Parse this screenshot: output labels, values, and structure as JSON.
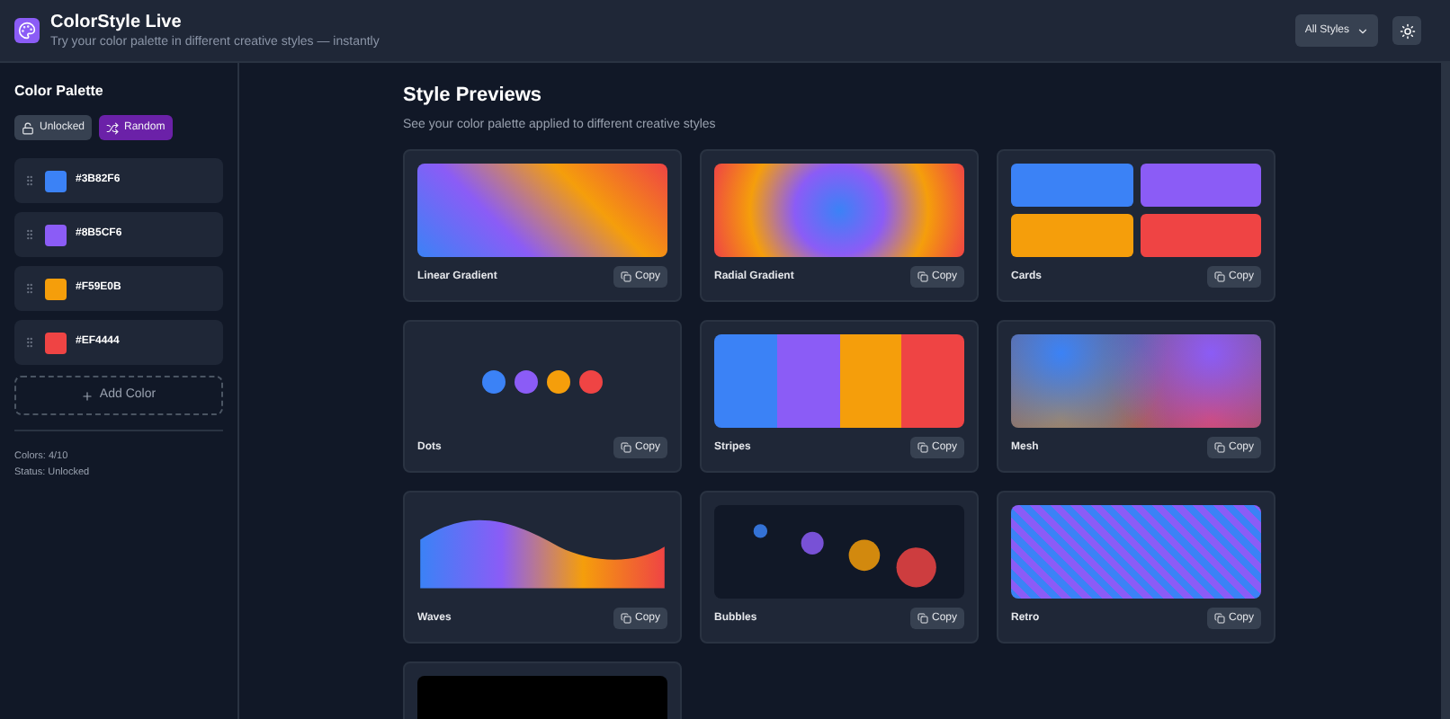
{
  "header": {
    "title": "ColorStyle Live",
    "subtitle": "Try your color palette in different creative styles — instantly",
    "style_select": "All Styles"
  },
  "sidebar": {
    "title": "Color Palette",
    "lock_button": {
      "label": "Unlocked",
      "locked": false
    },
    "random_button": "Random",
    "colors": [
      {
        "hex": "#3B82F6",
        "color": "#3b82f6"
      },
      {
        "hex": "#8B5CF6",
        "color": "#8b5cf6"
      },
      {
        "hex": "#F59E0B",
        "color": "#f59e0b"
      },
      {
        "hex": "#EF4444",
        "color": "#ef4444"
      }
    ],
    "add_button": "Add Color",
    "count": "Colors: 4/10",
    "status": "Status: Unlocked"
  },
  "main": {
    "title": "Style Previews",
    "subtitle": "See your color palette applied to different creative styles",
    "styles": [
      {
        "kind": "linear",
        "name": "Linear Gradient",
        "copy": "Copy"
      },
      {
        "kind": "radial",
        "name": "Radial Gradient",
        "copy": "Copy"
      },
      {
        "kind": "cards",
        "name": "Cards",
        "copy": "Copy"
      },
      {
        "kind": "dots",
        "name": "Dots",
        "copy": "Copy"
      },
      {
        "kind": "stripes",
        "name": "Stripes",
        "copy": "Copy"
      },
      {
        "kind": "mesh",
        "name": "Mesh",
        "copy": "Copy"
      },
      {
        "kind": "waves",
        "name": "Waves",
        "copy": "Copy"
      },
      {
        "kind": "bubbles",
        "name": "Bubbles",
        "copy": "Copy"
      },
      {
        "kind": "retro",
        "name": "Retro",
        "copy": "Copy"
      },
      {
        "kind": "glow"
      }
    ]
  }
}
